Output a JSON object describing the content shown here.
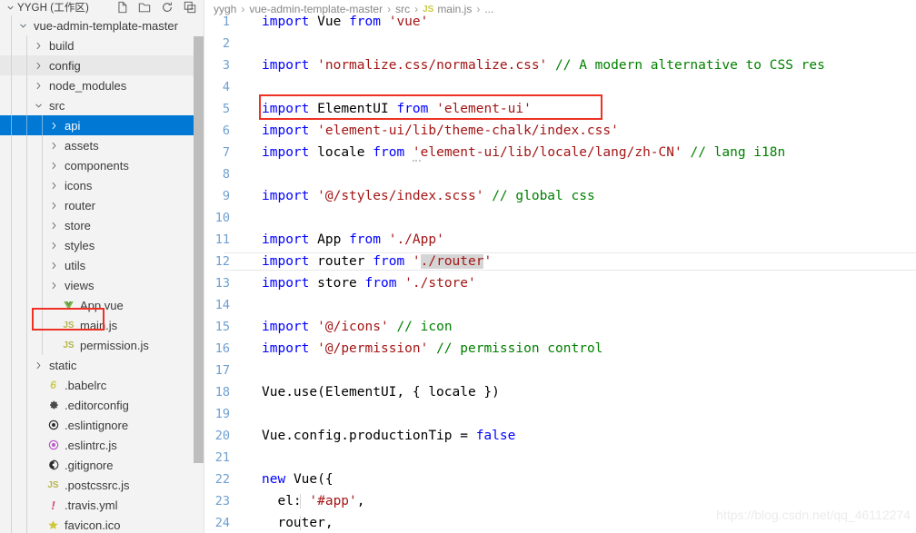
{
  "sidebar": {
    "title": "YYGH (工作区)",
    "actions": [
      {
        "name": "new-file-icon",
        "label": "New File"
      },
      {
        "name": "new-folder-icon",
        "label": "New Folder"
      },
      {
        "name": "refresh-icon",
        "label": "Refresh Explorer"
      },
      {
        "name": "collapse-all-icon",
        "label": "Collapse Folders in Explorer"
      }
    ],
    "scrollbar": {
      "visible": true
    },
    "items": [
      {
        "label": "vue-admin-template-master",
        "indent": 0,
        "twisty": "down",
        "icon": "none",
        "state": "normal"
      },
      {
        "label": "build",
        "indent": 1,
        "twisty": "right",
        "icon": "none",
        "state": "normal"
      },
      {
        "label": "config",
        "indent": 1,
        "twisty": "right",
        "icon": "none",
        "state": "hover"
      },
      {
        "label": "node_modules",
        "indent": 1,
        "twisty": "right",
        "icon": "none",
        "state": "normal"
      },
      {
        "label": "src",
        "indent": 1,
        "twisty": "down",
        "icon": "none",
        "state": "normal"
      },
      {
        "label": "api",
        "indent": 2,
        "twisty": "right",
        "icon": "none",
        "state": "selected"
      },
      {
        "label": "assets",
        "indent": 2,
        "twisty": "right",
        "icon": "none",
        "state": "normal"
      },
      {
        "label": "components",
        "indent": 2,
        "twisty": "right",
        "icon": "none",
        "state": "normal"
      },
      {
        "label": "icons",
        "indent": 2,
        "twisty": "right",
        "icon": "none",
        "state": "normal"
      },
      {
        "label": "router",
        "indent": 2,
        "twisty": "right",
        "icon": "none",
        "state": "normal"
      },
      {
        "label": "store",
        "indent": 2,
        "twisty": "right",
        "icon": "none",
        "state": "normal"
      },
      {
        "label": "styles",
        "indent": 2,
        "twisty": "right",
        "icon": "none",
        "state": "normal"
      },
      {
        "label": "utils",
        "indent": 2,
        "twisty": "right",
        "icon": "none",
        "state": "normal"
      },
      {
        "label": "views",
        "indent": 2,
        "twisty": "right",
        "icon": "none",
        "state": "normal"
      },
      {
        "label": "App.vue",
        "indent": 2,
        "twisty": "none",
        "icon": "vue-icon",
        "state": "normal"
      },
      {
        "label": "main.js",
        "indent": 2,
        "twisty": "none",
        "icon": "js-icon",
        "state": "normal"
      },
      {
        "label": "permission.js",
        "indent": 2,
        "twisty": "none",
        "icon": "js-icon",
        "state": "normal"
      },
      {
        "label": "static",
        "indent": 1,
        "twisty": "right",
        "icon": "none",
        "state": "normal"
      },
      {
        "label": ".babelrc",
        "indent": 1,
        "twisty": "none",
        "icon": "babel-icon",
        "state": "normal"
      },
      {
        "label": ".editorconfig",
        "indent": 1,
        "twisty": "none",
        "icon": "gear-icon",
        "state": "normal"
      },
      {
        "label": ".eslintignore",
        "indent": 1,
        "twisty": "none",
        "icon": "eslint-dark-icon",
        "state": "normal"
      },
      {
        "label": ".eslintrc.js",
        "indent": 1,
        "twisty": "none",
        "icon": "eslint-icon",
        "state": "normal"
      },
      {
        "label": ".gitignore",
        "indent": 1,
        "twisty": "none",
        "icon": "git-icon",
        "state": "normal"
      },
      {
        "label": ".postcssrc.js",
        "indent": 1,
        "twisty": "none",
        "icon": "js-icon",
        "state": "normal"
      },
      {
        "label": ".travis.yml",
        "indent": 1,
        "twisty": "none",
        "icon": "travis-icon",
        "state": "normal"
      },
      {
        "label": "favicon.ico",
        "indent": 1,
        "twisty": "none",
        "icon": "star-icon",
        "state": "normal"
      }
    ],
    "annotation_main_js": {
      "visible": true
    }
  },
  "breadcrumb": {
    "segments": [
      "yygh",
      "vue-admin-template-master",
      "src"
    ],
    "file_icon": "js-icon",
    "file": "main.js",
    "ellipsis": "..."
  },
  "editor": {
    "annotation_line5": {
      "visible": true
    },
    "lines": [
      {
        "n": "1",
        "tokens": [
          {
            "t": "import",
            "c": "kw"
          },
          {
            "t": " ",
            "c": "id"
          },
          {
            "t": "Vue",
            "c": "id"
          },
          {
            "t": " ",
            "c": "id"
          },
          {
            "t": "from",
            "c": "kw"
          },
          {
            "t": " ",
            "c": "id"
          },
          {
            "t": "'vue'",
            "c": "str"
          }
        ]
      },
      {
        "n": "2",
        "tokens": []
      },
      {
        "n": "3",
        "tokens": [
          {
            "t": "import",
            "c": "kw"
          },
          {
            "t": " ",
            "c": "id"
          },
          {
            "t": "'normalize.css/normalize.css'",
            "c": "str"
          },
          {
            "t": " ",
            "c": "id"
          },
          {
            "t": "// A modern alternative to CSS res",
            "c": "cmt"
          }
        ]
      },
      {
        "n": "4",
        "tokens": []
      },
      {
        "n": "5",
        "tokens": [
          {
            "t": "import",
            "c": "kw"
          },
          {
            "t": " ",
            "c": "id"
          },
          {
            "t": "ElementUI",
            "c": "id"
          },
          {
            "t": " ",
            "c": "id"
          },
          {
            "t": "from",
            "c": "kw"
          },
          {
            "t": " ",
            "c": "id"
          },
          {
            "t": "'element-ui'",
            "c": "str"
          }
        ]
      },
      {
        "n": "6",
        "tokens": [
          {
            "t": "import",
            "c": "kw"
          },
          {
            "t": " ",
            "c": "id"
          },
          {
            "t": "'element-ui/lib/theme-chalk/index.css'",
            "c": "str"
          }
        ]
      },
      {
        "n": "7",
        "tokens": [
          {
            "t": "import",
            "c": "kw"
          },
          {
            "t": " ",
            "c": "id"
          },
          {
            "t": "locale",
            "c": "id"
          },
          {
            "t": " ",
            "c": "id"
          },
          {
            "t": "from",
            "c": "kw"
          },
          {
            "t": " ",
            "c": "id"
          },
          {
            "t": "'",
            "c": "str squig"
          },
          {
            "t": "element-ui/lib/locale/lang/zh-CN'",
            "c": "str"
          },
          {
            "t": " ",
            "c": "id"
          },
          {
            "t": "// lang i18n",
            "c": "cmt"
          }
        ]
      },
      {
        "n": "8",
        "tokens": []
      },
      {
        "n": "9",
        "tokens": [
          {
            "t": "import",
            "c": "kw"
          },
          {
            "t": " ",
            "c": "id"
          },
          {
            "t": "'@/styles/index.scss'",
            "c": "str"
          },
          {
            "t": " ",
            "c": "id"
          },
          {
            "t": "// global css",
            "c": "cmt"
          }
        ]
      },
      {
        "n": "10",
        "tokens": []
      },
      {
        "n": "11",
        "tokens": [
          {
            "t": "import",
            "c": "kw"
          },
          {
            "t": " ",
            "c": "id"
          },
          {
            "t": "App",
            "c": "id"
          },
          {
            "t": " ",
            "c": "id"
          },
          {
            "t": "from",
            "c": "kw"
          },
          {
            "t": " ",
            "c": "id"
          },
          {
            "t": "'./App'",
            "c": "str"
          }
        ]
      },
      {
        "n": "12",
        "current": true,
        "tokens": [
          {
            "t": "import",
            "c": "kw"
          },
          {
            "t": " ",
            "c": "id"
          },
          {
            "t": "router",
            "c": "id"
          },
          {
            "t": " ",
            "c": "id"
          },
          {
            "t": "from",
            "c": "kw"
          },
          {
            "t": " ",
            "c": "id"
          },
          {
            "t": "'",
            "c": "str"
          },
          {
            "t": "./router",
            "c": "str sel-txt"
          },
          {
            "t": "'",
            "c": "str"
          }
        ]
      },
      {
        "n": "13",
        "tokens": [
          {
            "t": "import",
            "c": "kw"
          },
          {
            "t": " ",
            "c": "id"
          },
          {
            "t": "store",
            "c": "id"
          },
          {
            "t": " ",
            "c": "id"
          },
          {
            "t": "from",
            "c": "kw"
          },
          {
            "t": " ",
            "c": "id"
          },
          {
            "t": "'./store'",
            "c": "str"
          }
        ]
      },
      {
        "n": "14",
        "tokens": []
      },
      {
        "n": "15",
        "tokens": [
          {
            "t": "import",
            "c": "kw"
          },
          {
            "t": " ",
            "c": "id"
          },
          {
            "t": "'@/icons'",
            "c": "str"
          },
          {
            "t": " ",
            "c": "id"
          },
          {
            "t": "// icon",
            "c": "cmt"
          }
        ]
      },
      {
        "n": "16",
        "tokens": [
          {
            "t": "import",
            "c": "kw"
          },
          {
            "t": " ",
            "c": "id"
          },
          {
            "t": "'@/permission'",
            "c": "str"
          },
          {
            "t": " ",
            "c": "id"
          },
          {
            "t": "// permission control",
            "c": "cmt"
          }
        ]
      },
      {
        "n": "17",
        "tokens": []
      },
      {
        "n": "18",
        "tokens": [
          {
            "t": "Vue.use(ElementUI, { locale })",
            "c": "id"
          }
        ]
      },
      {
        "n": "19",
        "tokens": []
      },
      {
        "n": "20",
        "tokens": [
          {
            "t": "Vue.config.productionTip = ",
            "c": "id"
          },
          {
            "t": "false",
            "c": "kw"
          }
        ]
      },
      {
        "n": "21",
        "tokens": []
      },
      {
        "n": "22",
        "tokens": [
          {
            "t": "new",
            "c": "kw"
          },
          {
            "t": " ",
            "c": "id"
          },
          {
            "t": "Vue({",
            "c": "id"
          }
        ]
      },
      {
        "n": "23",
        "indent": true,
        "tokens": [
          {
            "t": "  el: ",
            "c": "id"
          },
          {
            "t": "'#app'",
            "c": "str"
          },
          {
            "t": ",",
            "c": "id"
          }
        ]
      },
      {
        "n": "24",
        "indent": true,
        "tokens": [
          {
            "t": "  router,",
            "c": "id"
          }
        ]
      }
    ]
  },
  "watermark": "https://blog.csdn.net/qq_46112274",
  "colors": {
    "selection_blue": "#0078d4",
    "annotation_red": "#ee3124",
    "keyword": "#0000ff",
    "string": "#a31515",
    "comment": "#008000",
    "line_number": "#6e9fd1",
    "sidebar_bg": "#f3f3f3"
  }
}
